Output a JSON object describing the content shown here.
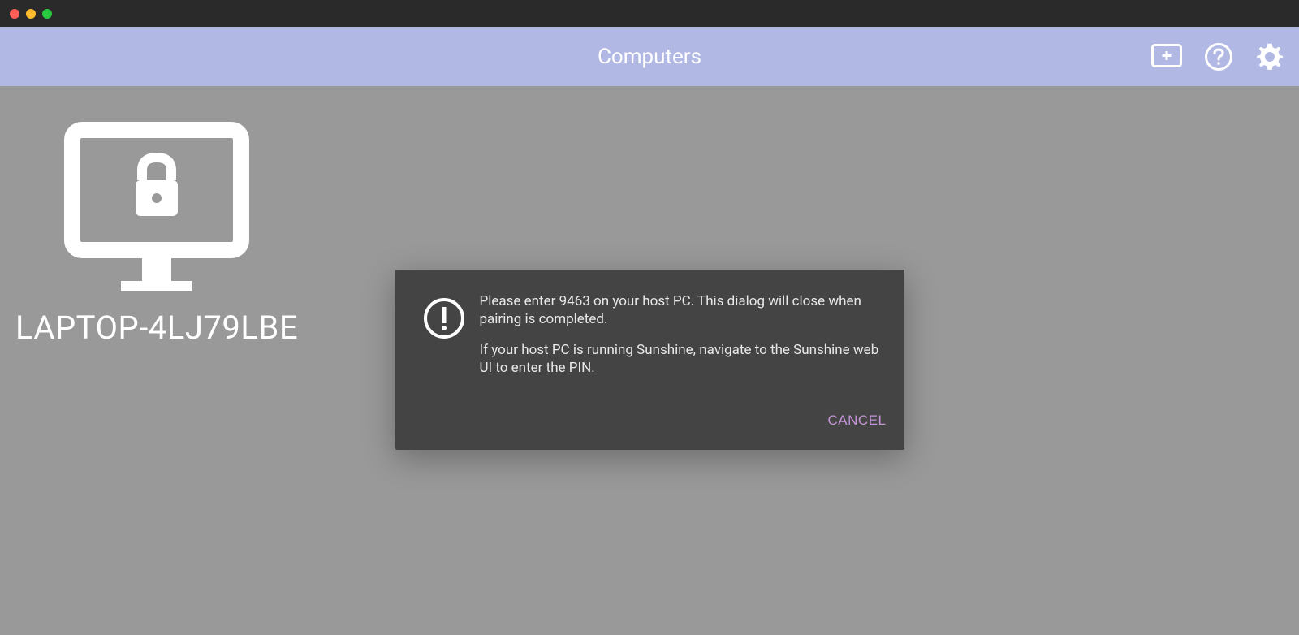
{
  "toolbar": {
    "title": "Computers"
  },
  "computers": [
    {
      "name": "LAPTOP-4LJ79LBE"
    }
  ],
  "dialog": {
    "message1": "Please enter 9463 on your host PC. This dialog will close when pairing is completed.",
    "message2": "If your host PC is running Sunshine, navigate to the Sunshine web UI to enter the PIN.",
    "cancel_label": "CANCEL"
  },
  "colors": {
    "toolbar_bg": "#b1b8e4",
    "dialog_bg": "#444444",
    "accent": "#c594d6"
  }
}
